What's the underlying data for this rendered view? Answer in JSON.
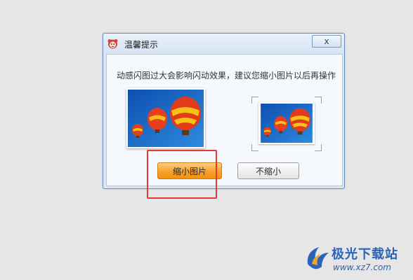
{
  "dialog": {
    "title": "温馨提示",
    "close_label": "x",
    "message": "动感闪图过大会影响闪动效果，建议您缩小图片以后再操作",
    "preview_large": "hot-air-balloons-image",
    "preview_small": "hot-air-balloons-image-resized",
    "buttons": {
      "shrink": "缩小图片",
      "no_shrink": "不缩小"
    }
  },
  "watermark": {
    "title": "极光下载站",
    "url": "www.xz7.com"
  },
  "colors": {
    "primary_button": "#f7a02a",
    "highlight": "#e53935",
    "titlebar": "#d6e4f5"
  }
}
